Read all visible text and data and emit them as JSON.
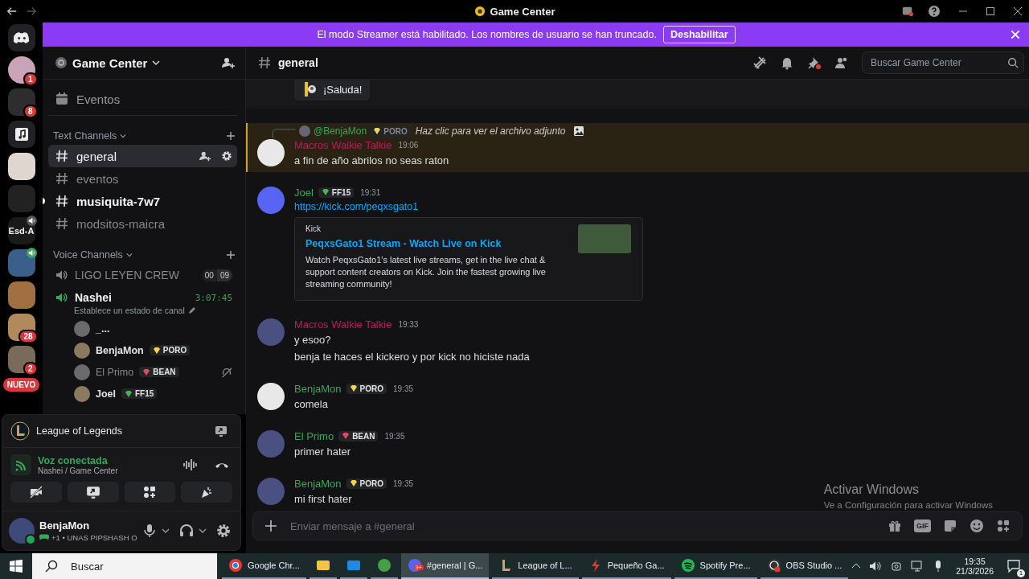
{
  "window": {
    "title": "Game Center"
  },
  "banner": {
    "text": "El modo Streamer está habilitado. Los nombres de usuario se han truncado.",
    "button": "Deshabilitar"
  },
  "servers": [
    {
      "kind": "home",
      "speaker": false
    },
    {
      "kind": "picture",
      "badge": "1",
      "speaker": false
    },
    {
      "kind": "picture",
      "badge": "8",
      "speaker": false
    },
    {
      "kind": "music",
      "speaker": false
    },
    {
      "kind": "picture",
      "speaker": false
    },
    {
      "kind": "picture",
      "speaker": false
    },
    {
      "kind": "text",
      "label": "Esd-A",
      "speaker": true
    },
    {
      "kind": "picture",
      "speaker": true
    },
    {
      "kind": "picture",
      "speaker": false
    },
    {
      "kind": "picture",
      "badge": "28",
      "speaker": false
    },
    {
      "kind": "picture",
      "badge": "2",
      "speaker": false
    }
  ],
  "new_label": "NUEVO",
  "sidebar": {
    "server_name": "Game Center",
    "events": "Eventos",
    "text_category": "Text Channels",
    "text_channels": [
      {
        "name": "general",
        "selected": true,
        "unread": false
      },
      {
        "name": "eventos",
        "selected": false,
        "unread": false
      },
      {
        "name": "musiquita-7w7",
        "selected": false,
        "unread": true
      },
      {
        "name": "modsitos-maicra",
        "selected": false,
        "unread": false
      }
    ],
    "voice_category": "Voice Channels",
    "voice_channels": [
      {
        "name": "LIGO LEYEN CREW",
        "connected": false,
        "count": "00",
        "limit": "09"
      },
      {
        "name": "Nashei",
        "connected": true,
        "timer": "3:07:45",
        "status": "Establece un estado de canal",
        "users": [
          {
            "name": "_...",
            "muted": false
          },
          {
            "name": "BenjaMon",
            "muted": false,
            "tag": {
              "label": "PORO",
              "color": "#f5d547"
            }
          },
          {
            "name": "El Primo",
            "muted": true,
            "tag": {
              "label": "BEAN",
              "color": "#e8475b"
            }
          },
          {
            "name": "Joel",
            "muted": false,
            "tag": {
              "label": "FF15",
              "color": "#4caf50"
            }
          }
        ]
      }
    ]
  },
  "panel": {
    "activity": "League of Legends",
    "voice_status": "Voz conectada",
    "voice_location": "Nashei / Game Center",
    "user": {
      "name": "BenjaMon",
      "online": true,
      "status": "+1 • UNAS PIPSHASH O"
    }
  },
  "chat": {
    "channel": "general",
    "search_placeholder": "Buscar Game Center",
    "wave_button": "¡Saluda!",
    "messages": [
      {
        "author": "Macros Walkie Talkie",
        "color": "#c2185b",
        "time": "19:06",
        "highlighted": true,
        "reply": {
          "author": "@BenjaMon",
          "tag": {
            "label": "PORO",
            "color": "#f5d547"
          },
          "text": "Haz clic para ver el archivo adjunto"
        },
        "lines": [
          "a fin de año abrilos no seas raton"
        ]
      },
      {
        "author": "Joel",
        "color": "#3ba55d",
        "time": "19:31",
        "highlighted": false,
        "tag": {
          "label": "FF15",
          "color": "#4caf50"
        },
        "link": "https://kick.com/peqxsgato1",
        "embed": {
          "provider": "Kick",
          "title": "PeqxsGato1 Stream - Watch Live on Kick",
          "description": "Watch PeqxsGato1's latest live streams, get in the live chat & support content creators on Kick. Join the fastest growing live streaming community!"
        }
      },
      {
        "author": "Macros Walkie Talkie",
        "color": "#c2185b",
        "time": "19:33",
        "highlighted": false,
        "lines": [
          "y esoo?",
          "benja te haces el kickero y por kick no hiciste nada"
        ]
      },
      {
        "author": "BenjaMon",
        "color": "#3ba55d",
        "time": "19:35",
        "highlighted": false,
        "tag": {
          "label": "PORO",
          "color": "#f5d547"
        },
        "lines": [
          "comela"
        ]
      },
      {
        "author": "El Primo",
        "color": "#3ba55d",
        "time": "19:35",
        "highlighted": false,
        "tag": {
          "label": "BEAN",
          "color": "#e8475b"
        },
        "lines": [
          "primer hater"
        ]
      },
      {
        "author": "BenjaMon",
        "color": "#3ba55d",
        "time": "19:35",
        "highlighted": false,
        "tag": {
          "label": "PORO",
          "color": "#f5d547"
        },
        "lines": [
          "mi first hater"
        ]
      }
    ],
    "composer_placeholder": "Enviar mensaje a #general",
    "gif_label": "GIF"
  },
  "activation": {
    "title": "Activar Windows",
    "text": "Ve a Configuración para activar Windows"
  },
  "taskbar": {
    "search": {
      "placeholder": "Buscar"
    },
    "apps": [
      {
        "kind": "chrome",
        "label": "Google Chr...",
        "selected": false
      },
      {
        "kind": "folder",
        "selected": false
      },
      {
        "kind": "mail",
        "selected": false
      },
      {
        "kind": "creature",
        "selected": false
      },
      {
        "kind": "discord",
        "label": "#general | G...",
        "badge": "9+",
        "selected": true
      },
      {
        "kind": "league",
        "label": "League of L...",
        "selected": false
      },
      {
        "kind": "bolt",
        "label": "Pequeño Ga...",
        "selected": false
      },
      {
        "kind": "spotify",
        "label": "Spotify Pre...",
        "selected": false
      },
      {
        "kind": "obs",
        "label": "OBS Studio ...",
        "selected": false
      }
    ],
    "time": "19:35",
    "date": "21/3/2026",
    "notifications": "1"
  }
}
